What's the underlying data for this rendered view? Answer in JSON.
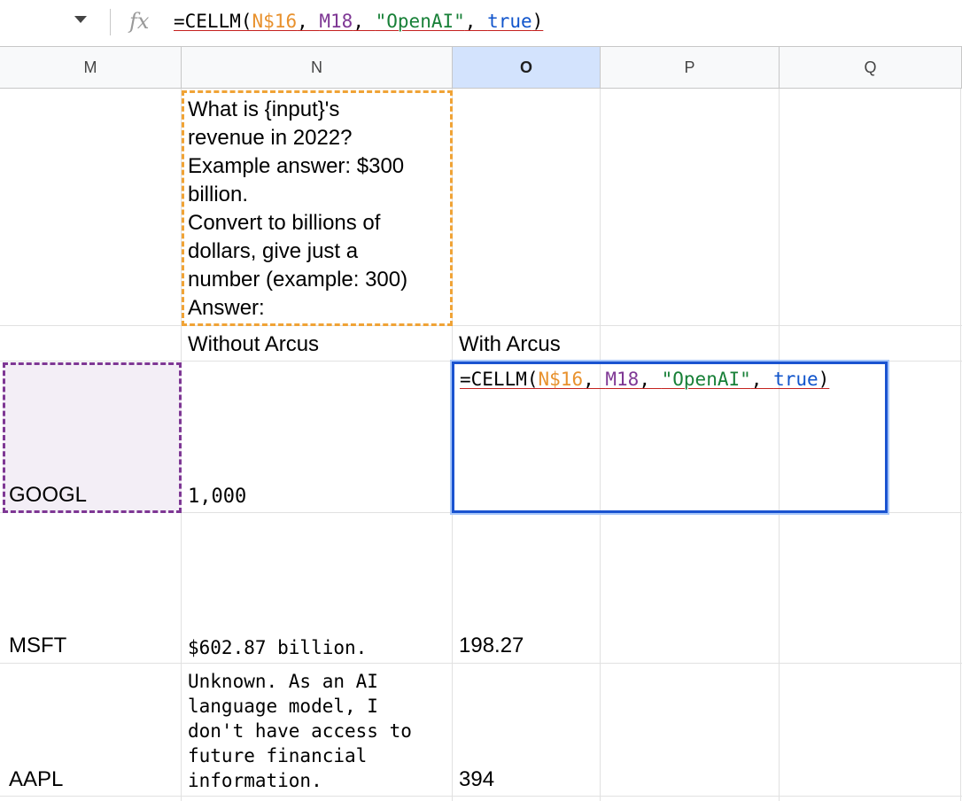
{
  "formula_bar": {
    "fx_label": "fx",
    "formula_tokens": [
      {
        "text": "=CELLM(",
        "kind": "fn"
      },
      {
        "text": "N$16",
        "kind": "r1"
      },
      {
        "text": ", ",
        "kind": "fn"
      },
      {
        "text": "M18",
        "kind": "r2"
      },
      {
        "text": ", ",
        "kind": "fn"
      },
      {
        "text": "\"OpenAI\"",
        "kind": "str"
      },
      {
        "text": ", ",
        "kind": "fn"
      },
      {
        "text": "true",
        "kind": "bool"
      },
      {
        "text": ")",
        "kind": "fn"
      }
    ]
  },
  "columns": [
    "M",
    "N",
    "O",
    "P",
    "Q"
  ],
  "selected_column": "O",
  "cells": {
    "prompt": "What is {input}'s\nrevenue in 2022?\nExample answer: $300\nbillion.\nConvert to billions of\ndollars, give just a\nnumber (example: 300)\nAnswer:",
    "header_without": "Without Arcus",
    "header_with": "With Arcus",
    "rows": [
      {
        "ticker": "GOOGL",
        "without": "1,000",
        "with": ""
      },
      {
        "ticker": "MSFT",
        "without": "$602.87 billion.",
        "with": "198.27"
      },
      {
        "ticker": "AAPL",
        "without": "Unknown. As an AI\nlanguage model, I\ndon't have access to\nfuture financial\ninformation.",
        "with": "394"
      }
    ]
  },
  "colors": {
    "selected_border": "#1a53d0",
    "ref_n16": "#e8912d",
    "ref_m18": "#7e3794",
    "string": "#188038",
    "boolean": "#1155cc"
  }
}
